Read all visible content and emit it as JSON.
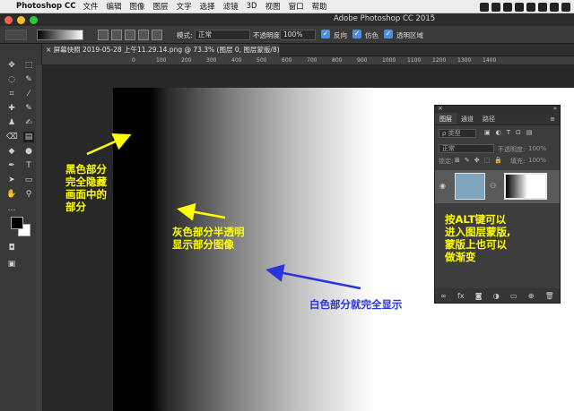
{
  "menubar": {
    "app": "Photoshop CC",
    "items": [
      "文件",
      "编辑",
      "图像",
      "图层",
      "文字",
      "选择",
      "滤镜",
      "3D",
      "视图",
      "窗口",
      "帮助"
    ]
  },
  "window": {
    "title": "Adobe Photoshop CC 2015"
  },
  "options": {
    "mode_label": "模式:",
    "mode_value": "正常",
    "opacity_label": "不透明度:",
    "opacity_value": "100%",
    "reverse_label": "反向",
    "dither_label": "仿色",
    "transparency_label": "透明区域"
  },
  "document": {
    "tab_title": "屏幕快照 2019-05-28 上午11.29.14.png @ 73.3% (图层 0, 图层蒙版/8) *"
  },
  "ruler": {
    "ticks": [
      "0",
      "100",
      "200",
      "300",
      "400",
      "500",
      "600",
      "700",
      "800",
      "900",
      "1000",
      "1100",
      "1200",
      "1300",
      "1400"
    ]
  },
  "annotations": {
    "black": [
      "黑色部分",
      "完全隐藏",
      "画面中的",
      "部分"
    ],
    "gray": [
      "灰色部分半透明",
      "显示部分图像"
    ],
    "white": "白色部分就完全显示",
    "alt": [
      "按ALT键可以",
      "进入图层蒙版,",
      "蒙版上也可以",
      "做渐变"
    ]
  },
  "layers_panel": {
    "tabs": [
      "图层",
      "通道",
      "路径"
    ],
    "filter_label": "ρ 类型",
    "blend_mode": "正常",
    "opacity_label": "不透明度:",
    "opacity_value": "100%",
    "lock_label": "锁定:",
    "fill_label": "填充:",
    "fill_value": "100%",
    "footer_icons": [
      "link-icon",
      "fx-icon",
      "mask-icon",
      "adjustment-icon",
      "folder-icon",
      "new-layer-icon",
      "trash-icon"
    ]
  },
  "colors": {
    "annotation_yellow": "#ffff00",
    "annotation_blue": "#2b34d8",
    "accent": "#4e8fd8"
  }
}
